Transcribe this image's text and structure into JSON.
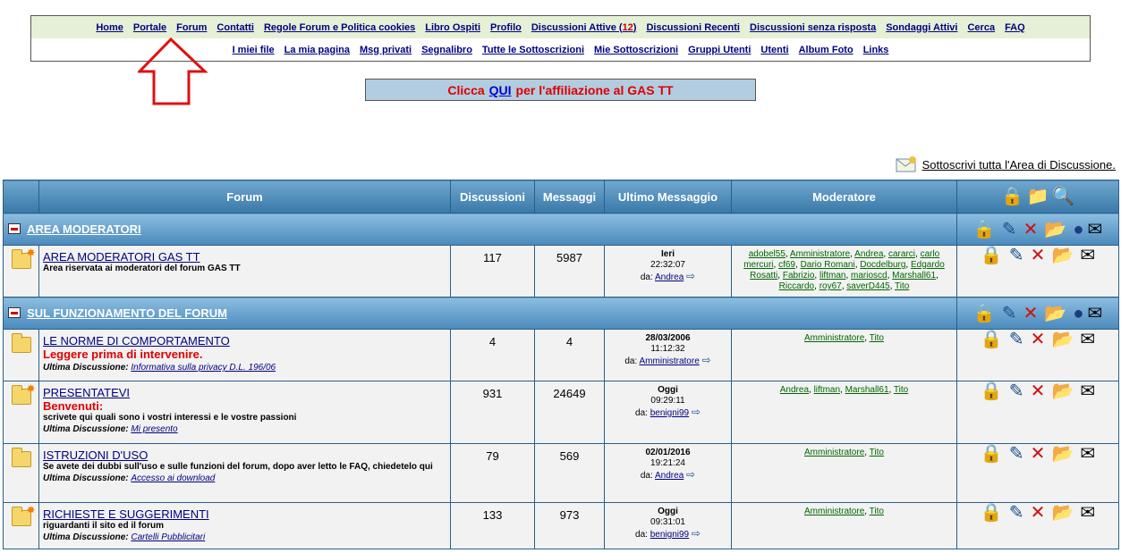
{
  "nav": {
    "row1": [
      "Home",
      "Portale",
      "Forum",
      "Contatti",
      "Regole Forum e Politica cookies",
      "Libro Ospiti",
      "Profilo"
    ],
    "active_prefix": "Discussioni Attive (",
    "active_count": "12",
    "active_suffix": ")",
    "row1b": [
      "Discussioni Recenti",
      "Discussioni senza risposta",
      "Sondaggi Attivi",
      "Cerca",
      "FAQ"
    ],
    "row2": [
      "I miei file",
      "La mia pagina",
      "Msg privati",
      "Segnalibro",
      "Tutte le Sottoscrizioni",
      "Mie Sottoscrizioni",
      "Gruppi Utenti",
      "Utenti",
      "Album Foto",
      "Links"
    ]
  },
  "affiliation": {
    "pre": "Clicca",
    "link": "QUI",
    "post": "per l'affiliazione al GAS TT"
  },
  "subscribe_all": "Sottoscrivi tutta l'Area di Discussione.",
  "table_headers": {
    "forum": "Forum",
    "topics": "Discussioni",
    "posts": "Messaggi",
    "last": "Ultimo Messaggio",
    "moderator": "Moderatore"
  },
  "labels": {
    "by": "da:",
    "last_topic": "Ultima Discussione:"
  },
  "categories": [
    {
      "name": "AREA MODERATORI"
    },
    {
      "name": "SUL FUNZIONAMENTO DEL FORUM"
    }
  ],
  "forums": [
    {
      "name": "AREA MODERATORI GAS TT",
      "desc": "Area riservata ai moderatori del forum GAS TT",
      "topics": "117",
      "posts": "5987",
      "last_date": "Ieri",
      "last_time": "22:32:07",
      "last_by": "Andrea",
      "mods": "adobel55, Amministratore, Andrea, cararci, carlo mercuri, cf69, Dario Romani, Docdelburg, Edgardo Rosatti, Fabrizio, liftman, marioscd, Marshall61, Riccardo, roy67, saverD445, Tito"
    },
    {
      "name": "LE NORME DI COMPORTAMENTO",
      "warn": "Leggere prima di intervenire.",
      "last_topic": "Informativa sulla privacy D.L. 196/06",
      "topics": "4",
      "posts": "4",
      "last_date": "28/03/2006",
      "last_time": "11:12:32",
      "last_by": "Amministratore",
      "mods": "Amministratore, Tito"
    },
    {
      "name": "PRESENTATEVI",
      "warn": "Benvenuti:",
      "desc": "scrivete qui quali sono i vostri interessi e le vostre passioni",
      "last_topic": "Mi presento",
      "topics": "931",
      "posts": "24649",
      "last_date": "Oggi",
      "last_time": "09:29:11",
      "last_by": "benigni99",
      "mods": "Andrea, liftman, Marshall61, Tito"
    },
    {
      "name": "ISTRUZIONI D'USO",
      "desc": "Se avete dei dubbi sull'uso e sulle funzioni del forum, dopo aver letto le FAQ, chiedetelo qui",
      "last_topic": "Accesso ai download",
      "topics": "79",
      "posts": "569",
      "last_date": "02/01/2016",
      "last_time": "19:21:24",
      "last_by": "Andrea",
      "mods": "Amministratore, Tito"
    },
    {
      "name": "RICHIESTE E SUGGERIMENTI",
      "desc": "riguardanti il sito ed il forum",
      "last_topic": "Cartelli Pubblicitari",
      "topics": "133",
      "posts": "973",
      "last_date": "Oggi",
      "last_time": "09:31:01",
      "last_by": "benigni99",
      "mods": "Amministratore, Tito"
    }
  ],
  "icons": {
    "lock": "lock-icon",
    "edit": "edit-icon",
    "delete": "delete-icon",
    "new": "new-topic-icon",
    "globe": "globe-icon",
    "mail": "subscribe-icon",
    "search": "search-icon",
    "arrow": "last-post-arrow-icon"
  }
}
